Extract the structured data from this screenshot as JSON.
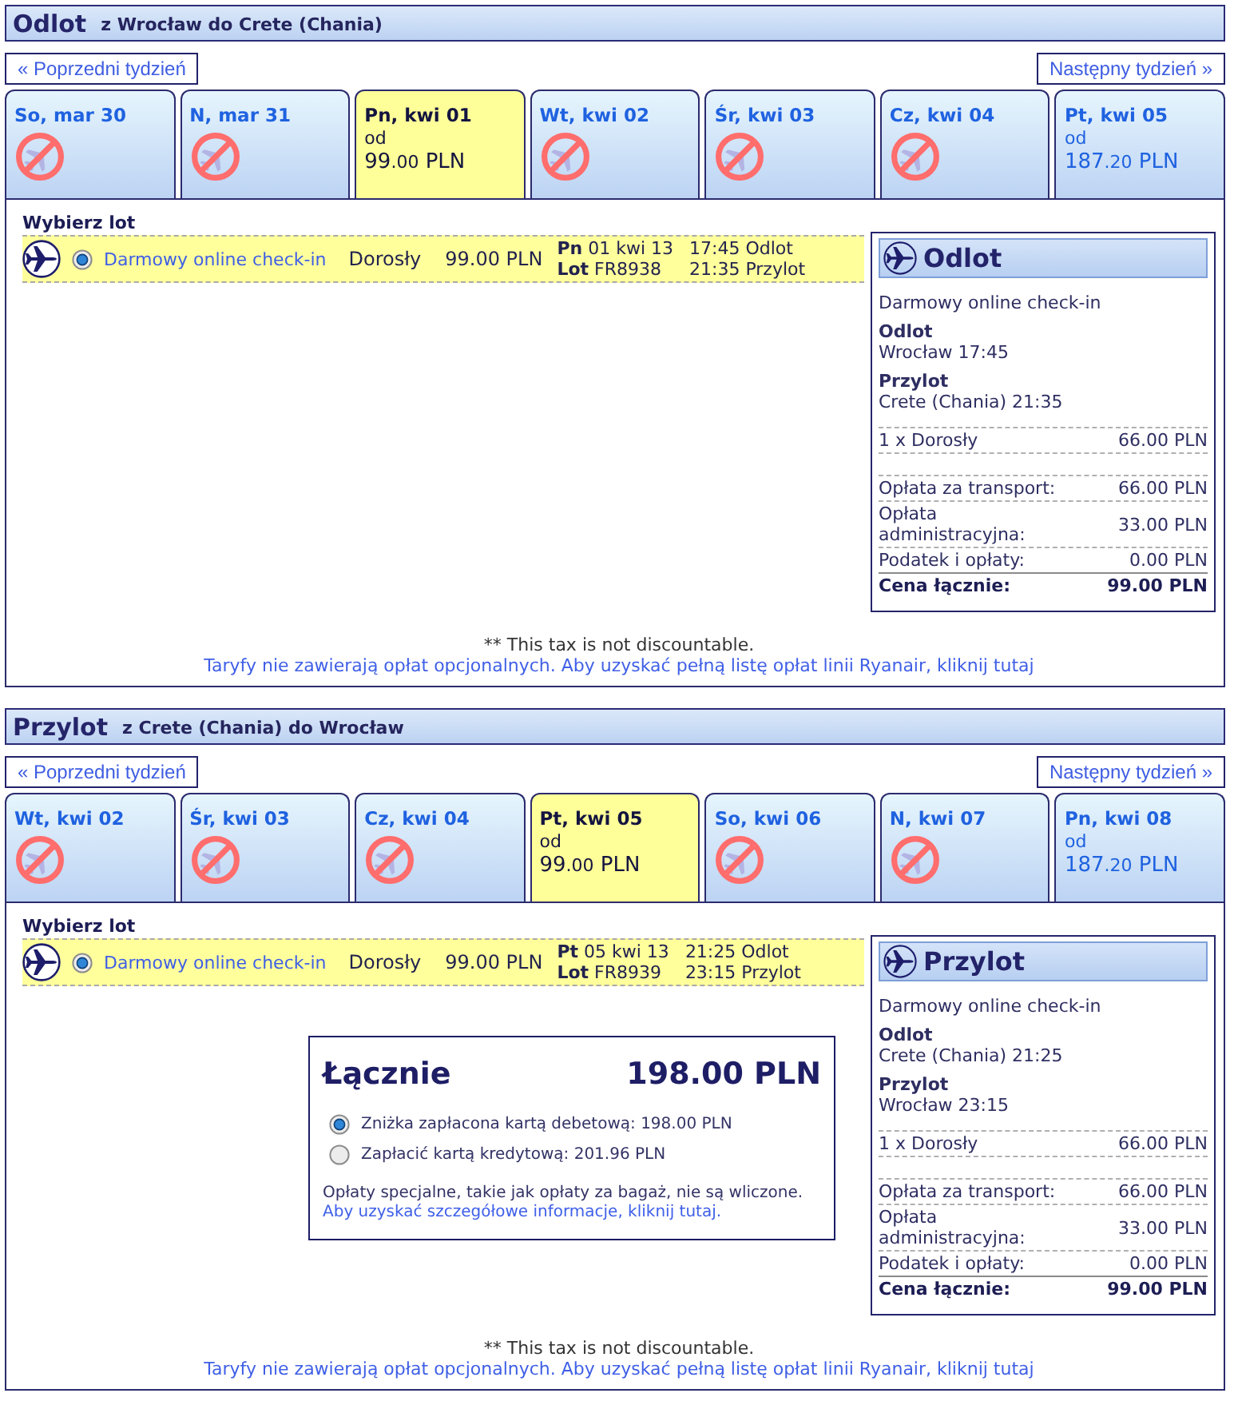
{
  "sections": [
    {
      "title": "Odlot",
      "route": "z Wrocław do Crete (Chania)",
      "prev_week": "« Poprzedni tydzień",
      "next_week": "Następny tydzień »",
      "days": [
        {
          "label": "So, mar 30",
          "available": false,
          "selected": false
        },
        {
          "label": "N, mar 31",
          "available": false,
          "selected": false
        },
        {
          "label": "Pn, kwi 01",
          "available": true,
          "selected": true,
          "from": "od",
          "price": "99",
          "decimals": ".00",
          "currency": "PLN"
        },
        {
          "label": "Wt, kwi 02",
          "available": false,
          "selected": false
        },
        {
          "label": "Śr, kwi 03",
          "available": false,
          "selected": false
        },
        {
          "label": "Cz, kwi 04",
          "available": false,
          "selected": false
        },
        {
          "label": "Pt, kwi 05",
          "available": true,
          "selected": false,
          "from": "od",
          "price": "187",
          "decimals": ".20",
          "currency": "PLN"
        }
      ],
      "choose_label": "Wybierz lot",
      "flights": [
        {
          "selected": true,
          "fare": "Darmowy online check-in",
          "passenger": "Dorosły",
          "price": "99.00 PLN",
          "date": "**Pn** 01 kwi 13",
          "flight": "**Lot** FR8938",
          "departure": "17:45 Odlot",
          "arrival": "21:35 Przylot"
        }
      ],
      "summary": {
        "title": "Odlot",
        "fare": "Darmowy online check-in",
        "legs": [
          {
            "label": "Odlot",
            "value": "Wrocław 17:45"
          },
          {
            "label": "Przylot",
            "value": "Crete (Chania) 21:35"
          }
        ],
        "passengers": [
          {
            "label": "1 x Dorosły",
            "amount": "66.00 PLN"
          }
        ],
        "fees": [
          {
            "label": "Opłata za transport:",
            "amount": "66.00 PLN"
          },
          {
            "label": "Opłata administracyjna:",
            "amount": "33.00 PLN"
          },
          {
            "label": "Podatek i opłaty:",
            "amount": "0.00 PLN"
          }
        ],
        "total": {
          "label": "Cena łącznie:",
          "amount": "99.00 PLN"
        }
      },
      "footnote": "** This tax is not discountable.",
      "fees_link": "Taryfy nie zawierają opłat opcjonalnych. Aby uzyskać pełną listę opłat linii Ryanair, kliknij tutaj"
    },
    {
      "title": "Przylot",
      "route": "z Crete (Chania) do Wrocław",
      "prev_week": "« Poprzedni tydzień",
      "next_week": "Następny tydzień »",
      "days": [
        {
          "label": "Wt, kwi 02",
          "available": false,
          "selected": false
        },
        {
          "label": "Śr, kwi 03",
          "available": false,
          "selected": false
        },
        {
          "label": "Cz, kwi 04",
          "available": false,
          "selected": false
        },
        {
          "label": "Pt, kwi 05",
          "available": true,
          "selected": true,
          "from": "od",
          "price": "99",
          "decimals": ".00",
          "currency": "PLN"
        },
        {
          "label": "So, kwi 06",
          "available": false,
          "selected": false
        },
        {
          "label": "N, kwi 07",
          "available": false,
          "selected": false
        },
        {
          "label": "Pn, kwi 08",
          "available": true,
          "selected": false,
          "from": "od",
          "price": "187",
          "decimals": ".20",
          "currency": "PLN"
        }
      ],
      "choose_label": "Wybierz lot",
      "flights": [
        {
          "selected": true,
          "fare": "Darmowy online check-in",
          "passenger": "Dorosły",
          "price": "99.00 PLN",
          "date": "**Pt** 05 kwi 13",
          "flight": "**Lot** FR8939",
          "departure": "21:25 Odlot",
          "arrival": "23:15 Przylot"
        }
      ],
      "grand_total": {
        "title": "Łącznie",
        "amount": "198.00 PLN",
        "options": [
          {
            "label": "Zniżka zapłacona kartą debetową: 198.00 PLN",
            "selected": true
          },
          {
            "label": "Zapłacić kartą kredytową: 201.96 PLN",
            "selected": false
          }
        ],
        "note": "Opłaty specjalne, takie jak opłaty za bagaż, nie są wliczone.",
        "link": "Aby uzyskać szczegółowe informacje, kliknij tutaj."
      },
      "summary": {
        "title": "Przylot",
        "fare": "Darmowy online check-in",
        "legs": [
          {
            "label": "Odlot",
            "value": "Crete (Chania) 21:25"
          },
          {
            "label": "Przylot",
            "value": "Wrocław 23:15"
          }
        ],
        "passengers": [
          {
            "label": "1 x Dorosły",
            "amount": "66.00 PLN"
          }
        ],
        "fees": [
          {
            "label": "Opłata za transport:",
            "amount": "66.00 PLN"
          },
          {
            "label": "Opłata administracyjna:",
            "amount": "33.00 PLN"
          },
          {
            "label": "Podatek i opłaty:",
            "amount": "0.00 PLN"
          }
        ],
        "total": {
          "label": "Cena łącznie:",
          "amount": "99.00 PLN"
        }
      },
      "footnote": "** This tax is not discountable.",
      "fees_link": "Taryfy nie zawierają opłat opcjonalnych. Aby uzyskać pełną listę opłat linii Ryanair, kliknij tutaj"
    }
  ]
}
